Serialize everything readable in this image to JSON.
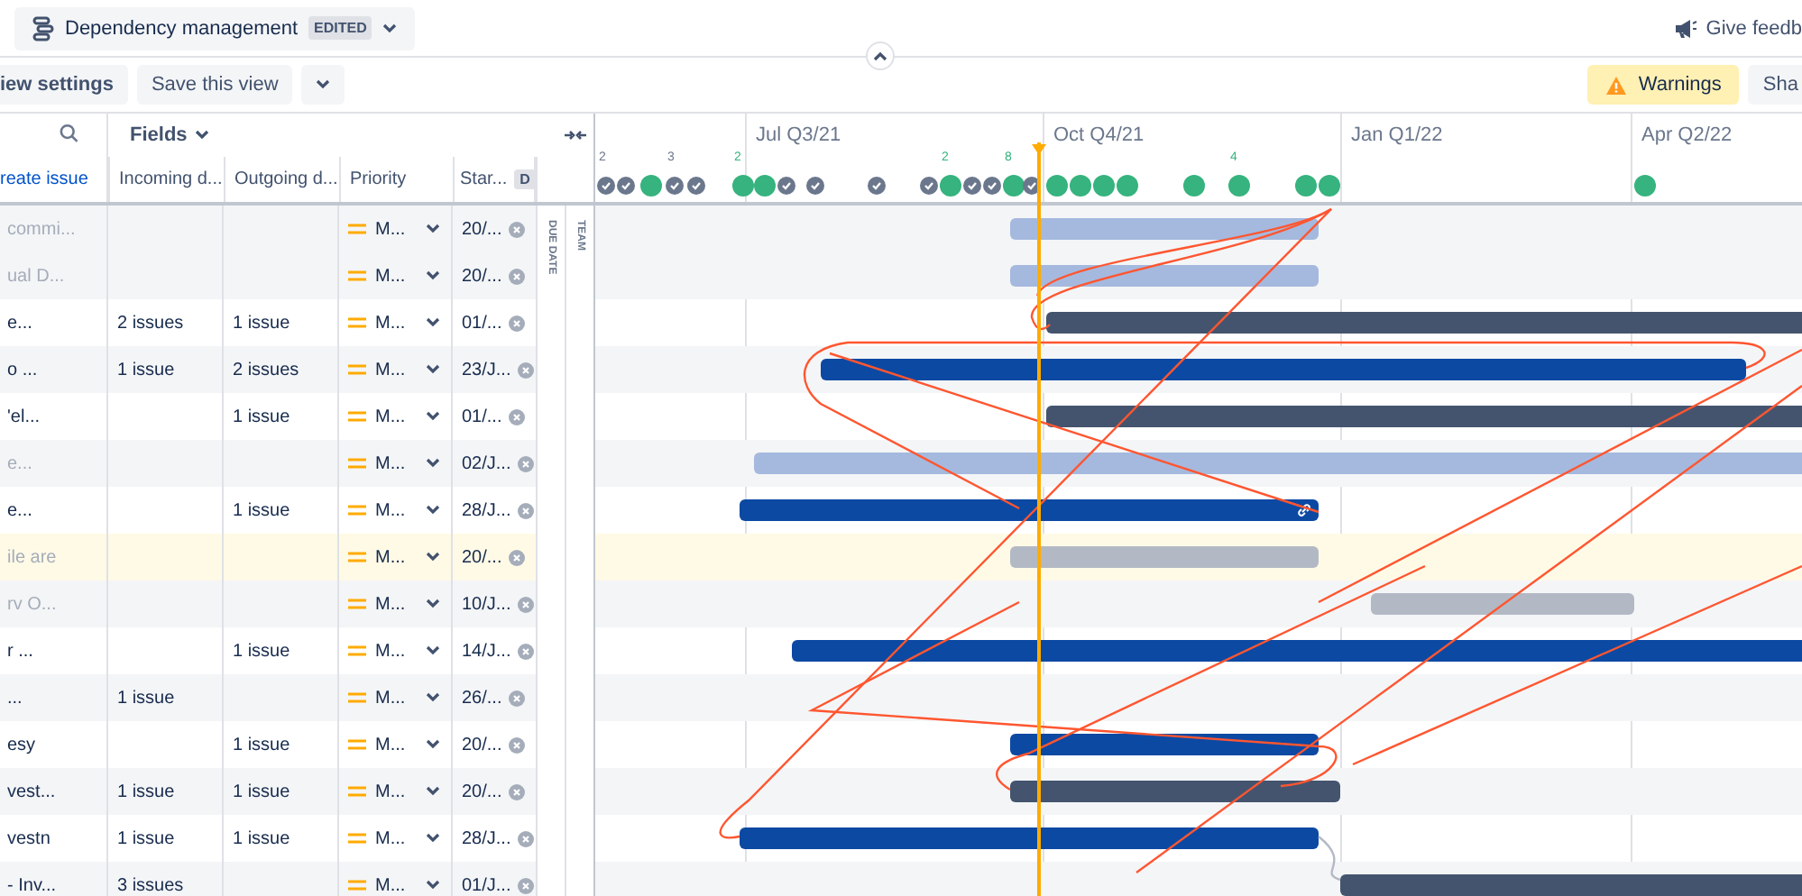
{
  "header": {
    "view_name": "Dependency management",
    "badge": "EDITED",
    "feedback": "Give feedb"
  },
  "toolbar": {
    "view_settings": "iew settings",
    "save_view": "Save this view",
    "warnings": "Warnings",
    "share": "Sha"
  },
  "table": {
    "create_issue": "reate issue",
    "fields": "Fields",
    "columns": [
      "Incoming d...",
      "Outgoing d...",
      "Priority",
      "Star..."
    ],
    "start_badge": "D",
    "due_label": "DUE DATE",
    "team_label": "TEAM",
    "rows": [
      {
        "title": "commi...",
        "dimmed": true,
        "shaded": true,
        "highlighted": false,
        "incoming": "",
        "outgoing": "",
        "priority": "M...",
        "start": "20/...",
        "bar": {
          "color": "#a5b9de",
          "link": false
        }
      },
      {
        "title": "ual D...",
        "dimmed": true,
        "shaded": true,
        "highlighted": false,
        "incoming": "",
        "outgoing": "",
        "priority": "M...",
        "start": "20/...",
        "bar": {
          "color": "#a5b9de",
          "link": false
        }
      },
      {
        "title": "e...",
        "dimmed": false,
        "shaded": false,
        "highlighted": false,
        "incoming": "2 issues",
        "outgoing": "1 issue",
        "priority": "M...",
        "start": "01/...",
        "bar": {
          "color": "#44546f",
          "link": false
        }
      },
      {
        "title": "o ...",
        "dimmed": false,
        "shaded": true,
        "highlighted": false,
        "incoming": "1 issue",
        "outgoing": "2 issues",
        "priority": "M...",
        "start": "23/J...",
        "bar": {
          "color": "#0c49a3",
          "link": false
        }
      },
      {
        "title": "'el...",
        "dimmed": false,
        "shaded": false,
        "highlighted": false,
        "incoming": "",
        "outgoing": "1 issue",
        "priority": "M...",
        "start": "01/...",
        "bar": {
          "color": "#44546f",
          "link": false
        }
      },
      {
        "title": "e...",
        "dimmed": true,
        "shaded": true,
        "highlighted": false,
        "incoming": "",
        "outgoing": "",
        "priority": "M...",
        "start": "02/J...",
        "bar": {
          "color": "#a5b9de",
          "link": false
        }
      },
      {
        "title": "e...",
        "dimmed": false,
        "shaded": false,
        "highlighted": false,
        "incoming": "",
        "outgoing": "1 issue",
        "priority": "M...",
        "start": "28/J...",
        "bar": {
          "color": "#0c49a3",
          "link": true
        }
      },
      {
        "title": "ile are",
        "dimmed": true,
        "shaded": false,
        "highlighted": true,
        "incoming": "",
        "outgoing": "",
        "priority": "M...",
        "start": "20/...",
        "bar": {
          "color": "#b3b9c4",
          "link": false
        }
      },
      {
        "title": "rv O...",
        "dimmed": true,
        "shaded": true,
        "highlighted": false,
        "incoming": "",
        "outgoing": "",
        "priority": "M...",
        "start": "10/J...",
        "bar": {
          "color": "#b3b9c4",
          "link": false
        }
      },
      {
        "title": "r ...",
        "dimmed": false,
        "shaded": false,
        "highlighted": false,
        "incoming": "",
        "outgoing": "1 issue",
        "priority": "M...",
        "start": "14/J...",
        "bar": {
          "color": "#0c49a3",
          "link": false
        }
      },
      {
        "title": "...",
        "dimmed": false,
        "shaded": true,
        "highlighted": false,
        "incoming": "1 issue",
        "outgoing": "",
        "priority": "M...",
        "start": "26/..."
      },
      {
        "title": "esy",
        "dimmed": false,
        "shaded": false,
        "highlighted": false,
        "incoming": "",
        "outgoing": "1 issue",
        "priority": "M...",
        "start": "20/...",
        "bar": {
          "color": "#0c49a3",
          "link": false
        }
      },
      {
        "title": "vest...",
        "dimmed": false,
        "shaded": true,
        "highlighted": false,
        "incoming": "1 issue",
        "outgoing": "1 issue",
        "priority": "M...",
        "start": "20/...",
        "bar": {
          "color": "#44546f",
          "link": false
        }
      },
      {
        "title": "vestn",
        "dimmed": false,
        "shaded": false,
        "highlighted": false,
        "incoming": "1 issue",
        "outgoing": "1 issue",
        "priority": "M...",
        "start": "28/J...",
        "bar": {
          "color": "#0c49a3",
          "link": false
        }
      },
      {
        "title": "- Inv...",
        "dimmed": false,
        "shaded": true,
        "highlighted": false,
        "incoming": "3 issues",
        "outgoing": "",
        "priority": "M...",
        "start": "01/J...",
        "bar": {
          "color": "#44546f",
          "link": false
        }
      }
    ]
  },
  "timeline": {
    "quarters": [
      "Jul Q3/21",
      "Oct Q4/21",
      "Jan Q1/22",
      "Apr Q2/22"
    ],
    "counts": [
      {
        "text": "2",
        "kind": "done"
      },
      {
        "text": "3",
        "kind": "done"
      },
      {
        "text": "2",
        "kind": "open"
      },
      {
        "text": "2",
        "kind": "open"
      },
      {
        "text": "8",
        "kind": "open"
      },
      {
        "text": "4",
        "kind": "open"
      }
    ],
    "markers": [
      {
        "kind": "done"
      },
      {
        "kind": "done"
      },
      {
        "kind": "open"
      },
      {
        "kind": "done"
      },
      {
        "kind": "done"
      },
      {
        "kind": "open"
      },
      {
        "kind": "open"
      },
      {
        "kind": "done"
      },
      {
        "kind": "done"
      },
      {
        "kind": "done"
      },
      {
        "kind": "done"
      },
      {
        "kind": "open"
      },
      {
        "kind": "done"
      },
      {
        "kind": "done"
      },
      {
        "kind": "open"
      },
      {
        "kind": "done"
      },
      {
        "kind": "open"
      },
      {
        "kind": "open"
      },
      {
        "kind": "open"
      },
      {
        "kind": "open"
      },
      {
        "kind": "open"
      },
      {
        "kind": "open"
      },
      {
        "kind": "open"
      },
      {
        "kind": "open"
      },
      {
        "kind": "open"
      }
    ]
  }
}
